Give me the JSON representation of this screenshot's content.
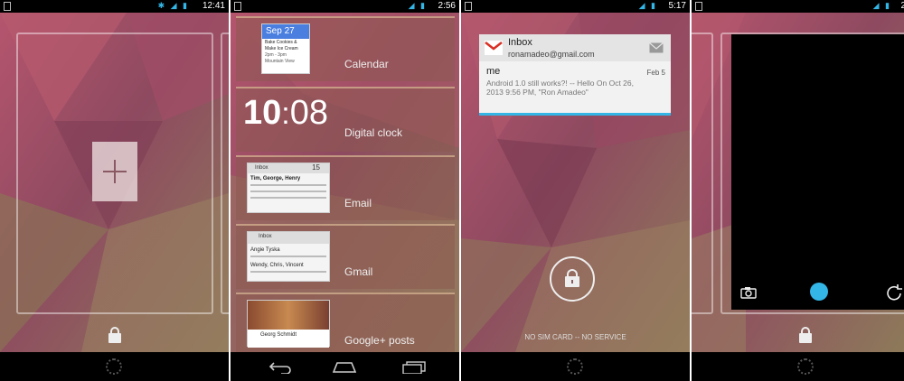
{
  "panels": {
    "p1": {
      "status_time": "12:41"
    },
    "p2": {
      "status_time": "2:56",
      "widgets": [
        {
          "label": "Calendar",
          "date": "Sep 27",
          "line1": "Bake Cookies &",
          "line2": "Make Ice Cream",
          "line3": "2pm - 3pm",
          "line4": "Mountain View"
        },
        {
          "label": "Digital clock",
          "hour": "10",
          "minute": "08"
        },
        {
          "label": "Email",
          "title": "Inbox",
          "count": "15",
          "line1": "Tim, George, Henry"
        },
        {
          "label": "Gmail",
          "title": "Inbox",
          "line1": "Angie Tyska",
          "line2": "Wendy, Chris, Vincent"
        },
        {
          "label": "Google+ posts",
          "line1": "Georg Schmidt"
        }
      ]
    },
    "p3": {
      "status_time": "5:17",
      "gmail": {
        "title": "Inbox",
        "account": "ronamadeo@gmail.com",
        "sender": "me",
        "date": "Feb 5",
        "snippet1": "Android 1.0 still works?! -- Hello On Oct 26,",
        "snippet2": "2013 9:56 PM, \"Ron Amadeo\""
      },
      "carrier": "NO SIM CARD -- NO SERVICE"
    },
    "p4": {
      "status_time": "2"
    }
  },
  "colors": {
    "accent_blue": "#33b5e5"
  }
}
